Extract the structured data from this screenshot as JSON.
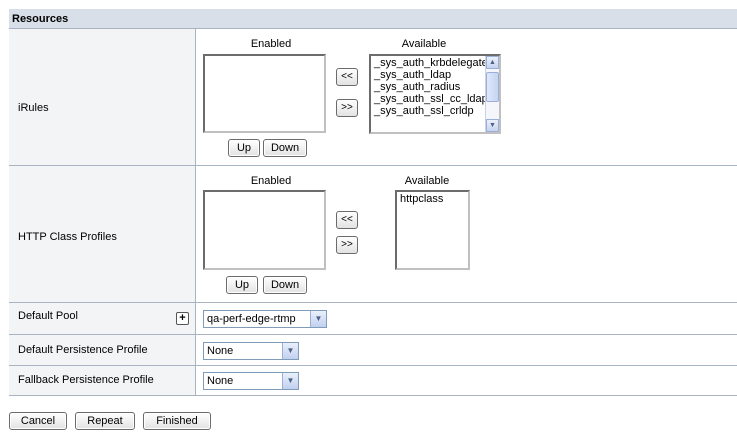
{
  "section": {
    "title": "Resources"
  },
  "irules": {
    "label": "iRules",
    "enabled_title": "Enabled",
    "available_title": "Available",
    "enabled_items": [],
    "available_items": [
      "_sys_auth_krbdelegate",
      "_sys_auth_ldap",
      "_sys_auth_radius",
      "_sys_auth_ssl_cc_ldap",
      "_sys_auth_ssl_crldp"
    ],
    "move_left": "<<",
    "move_right": ">>",
    "up": "Up",
    "down": "Down"
  },
  "http_class": {
    "label": "HTTP Class Profiles",
    "enabled_title": "Enabled",
    "available_title": "Available",
    "enabled_items": [],
    "available_items": [
      "httpclass"
    ],
    "move_left": "<<",
    "move_right": ">>",
    "up": "Up",
    "down": "Down"
  },
  "default_pool": {
    "label": "Default Pool",
    "plus": "+",
    "value": "qa-perf-edge-rtmp"
  },
  "default_persistence": {
    "label": "Default Persistence Profile",
    "value": "None"
  },
  "fallback_persistence": {
    "label": "Fallback Persistence Profile",
    "value": "None"
  },
  "footer": {
    "cancel": "Cancel",
    "repeat": "Repeat",
    "finished": "Finished"
  },
  "icons": {
    "dropdown": "chevron-down-icon",
    "scroll_up": "scroll-up-icon",
    "scroll_down": "scroll-down-icon"
  }
}
